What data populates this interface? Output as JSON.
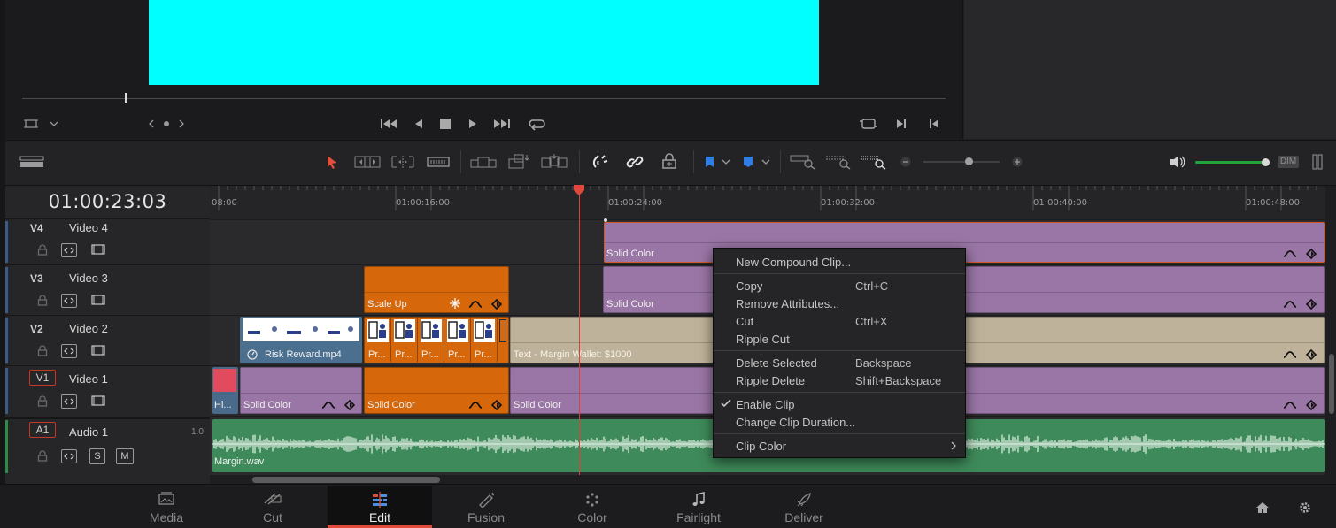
{
  "viewer": {
    "transport": [
      "jump-to-start",
      "play-reverse",
      "stop",
      "play",
      "jump-to-end",
      "loop"
    ]
  },
  "timeline": {
    "timecode": "01:00:23:03",
    "ruler_labels": [
      "08:00",
      "01:00:16:00",
      "01:00:24:00",
      "01:00:32:00",
      "01:00:40:00",
      "01:00:48:00"
    ],
    "tracks": [
      {
        "id": "V4",
        "name": "Video 4"
      },
      {
        "id": "V3",
        "name": "Video 3"
      },
      {
        "id": "V2",
        "name": "Video 2"
      },
      {
        "id": "V1",
        "name": "Video 1"
      },
      {
        "id": "A1",
        "name": "Audio 1",
        "level": "1.0",
        "solo": "S",
        "mute": "M"
      }
    ],
    "clips": {
      "v4_solid": "Solid Color",
      "v3_scale": "Scale Up",
      "v3_solid": "Solid Color",
      "v2_risk": "Risk Reward.mp4",
      "v2_pr": [
        "Pr...",
        "Pr...",
        "Pr...",
        "Pr...",
        "Pr..."
      ],
      "v2_text": "Text - Margin Wallet: $1000",
      "v1_hi": "Hi...",
      "v1_solid_a": "Solid Color",
      "v1_solid_b": "Solid Color",
      "v1_solid_c": "Solid Color",
      "a1_audio": "Margin.wav"
    },
    "audio": {
      "dim_label": "DIM"
    }
  },
  "context_menu": {
    "new_compound": "New Compound Clip...",
    "copy": "Copy",
    "copy_sc": "Ctrl+C",
    "remove_attr": "Remove Attributes...",
    "cut": "Cut",
    "cut_sc": "Ctrl+X",
    "ripple_cut": "Ripple Cut",
    "delete_selected": "Delete Selected",
    "delete_sc": "Backspace",
    "ripple_delete": "Ripple Delete",
    "ripple_delete_sc": "Shift+Backspace",
    "enable_clip": "Enable Clip",
    "enable_checked": true,
    "change_duration": "Change Clip Duration...",
    "clip_color": "Clip Color"
  },
  "pages": {
    "media": "Media",
    "cut": "Cut",
    "edit": "Edit",
    "fusion": "Fusion",
    "color": "Color",
    "fairlight": "Fairlight",
    "deliver": "Deliver",
    "active": "Edit"
  },
  "colors": {
    "viewer_fill": "#00ffff",
    "solid_clip": "#9a76a6",
    "orange_clip": "#d6670a",
    "text_clip": "#bfb29a",
    "audio_clip": "#3e8a5a",
    "playhead": "#d9443a",
    "accent": "#e04b3a"
  }
}
